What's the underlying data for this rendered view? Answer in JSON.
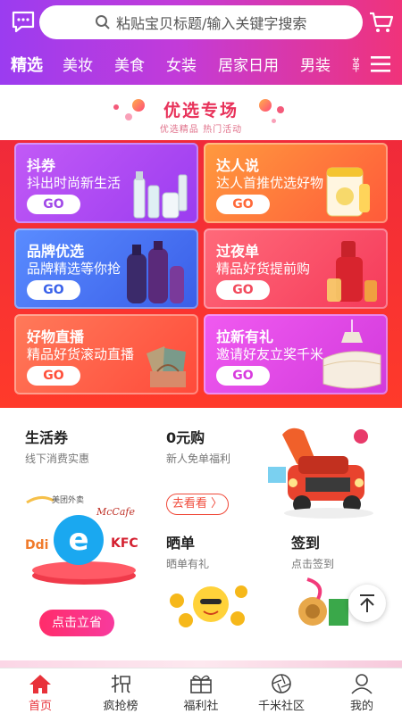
{
  "header": {
    "search_placeholder": "粘贴宝贝标题/输入关键字搜索",
    "tabs": [
      "精选",
      "美妆",
      "美食",
      "女装",
      "居家日用",
      "男装",
      "鞋"
    ]
  },
  "section": {
    "title": "优选专场",
    "subtitle": "优选精品 热门活动"
  },
  "cards": [
    {
      "title": "抖券",
      "subtitle": "抖出时尚新生活",
      "go": "GO",
      "color": "#b04ff2"
    },
    {
      "title": "达人说",
      "subtitle": "达人首推优选好物",
      "go": "GO",
      "color": "#ff7a3a"
    },
    {
      "title": "品牌优选",
      "subtitle": "品牌精选等你抢",
      "go": "GO",
      "color": "#4b78f5"
    },
    {
      "title": "过夜单",
      "subtitle": "精品好货提前购",
      "go": "GO",
      "color": "#ff4d6d"
    },
    {
      "title": "好物直播",
      "subtitle": "精品好货滚动直播",
      "go": "GO",
      "color": "#ff5a4a"
    },
    {
      "title": "拉新有礼",
      "subtitle": "邀请好友立奖千米",
      "go": "GO",
      "color": "#e84ae8"
    }
  ],
  "lower": {
    "life": {
      "title": "生活券",
      "subtitle": "线下消费实惠",
      "button": "点击立省",
      "brands": [
        "美团外卖",
        "McCafe",
        "KFC",
        "Ddi"
      ]
    },
    "zero": {
      "title": "0元购",
      "subtitle": "新人免单福利",
      "button": "去看看 〉"
    },
    "share": {
      "title": "晒单",
      "subtitle": "晒单有礼"
    },
    "checkin": {
      "title": "签到",
      "subtitle": "点击签到"
    }
  },
  "bottom_nav": [
    {
      "label": "首页",
      "icon": "home-icon",
      "active": true
    },
    {
      "label": "疯抢榜",
      "icon": "rush-icon",
      "active": false
    },
    {
      "label": "福利社",
      "icon": "gift-icon",
      "active": false
    },
    {
      "label": "千米社区",
      "icon": "aperture-icon",
      "active": false
    },
    {
      "label": "我的",
      "icon": "user-icon",
      "active": false
    }
  ],
  "colors": {
    "accent": "#e8323a",
    "header_start": "#9b3cf0",
    "header_end": "#f0337a"
  }
}
